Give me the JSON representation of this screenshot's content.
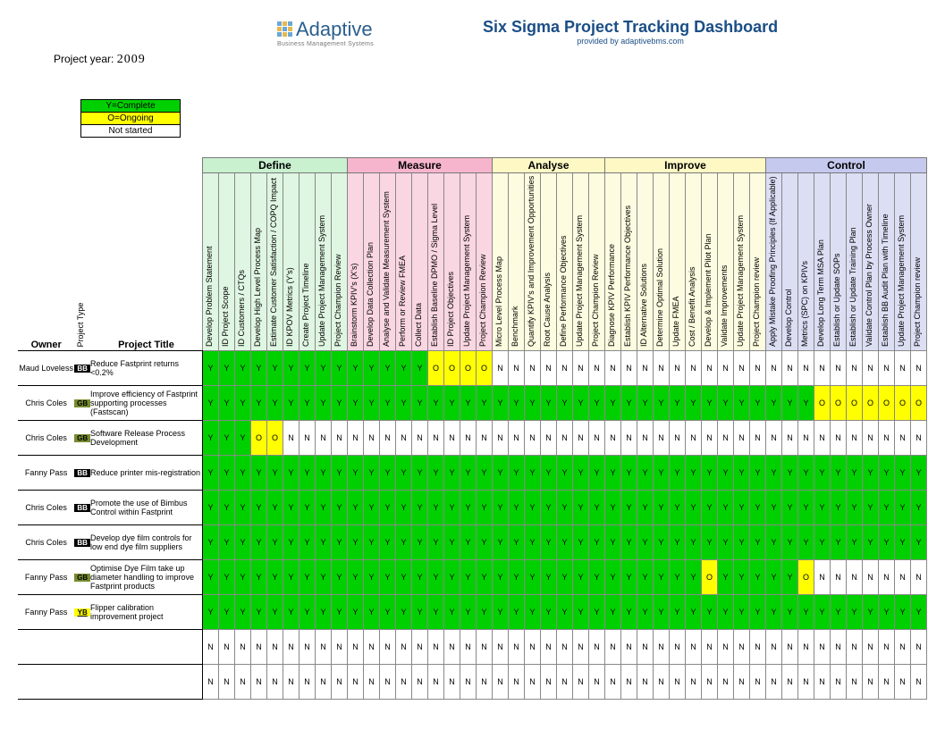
{
  "header": {
    "logo_name": "Adaptive",
    "logo_sub": "Business Management Systems",
    "title": "Six Sigma Project Tracking Dashboard",
    "subtitle": "provided by adaptivebms.com",
    "year_label": "Project year:",
    "year_value": "2009"
  },
  "legend": {
    "complete": "Y=Complete",
    "ongoing": "O=Ongoing",
    "notstarted": "Not started"
  },
  "row_headers": {
    "owner": "Owner",
    "type": "Project Type",
    "title": "Project Title"
  },
  "phases": [
    {
      "name": "Define",
      "cls": "define",
      "cols": [
        "Develop Problem Statement",
        "ID Project Scope",
        "ID Customers / CTQs",
        "Develop High Level Process Map",
        "Estimate Customer Satisfaction / COPQ Impact",
        "ID KPOV Metrics (Y's)",
        "Create Project Timeline",
        "Update Project Management System",
        "Project Champion Review"
      ]
    },
    {
      "name": "Measure",
      "cls": "measure",
      "cols": [
        "Brainstorm KPIV's (X's)",
        "Develop Data Collection Plan",
        "Analyse and Validate Measurement System",
        "Perform or Review FMEA",
        "Collect Data",
        "Establish Baseline DPMO / Sigma Level",
        "ID Project Objectives",
        "Update Project Management System",
        "Project Champion Review"
      ]
    },
    {
      "name": "Analyse",
      "cls": "analyse",
      "cols": [
        "Micro Level Process Map",
        "Benchmark",
        "Quantify KPIV's and Improvement Opportunities",
        "Root Cause Analysis",
        "Define Performance Objectives",
        "Update Project Management System",
        "Project Champion Review"
      ]
    },
    {
      "name": "Improve",
      "cls": "improve",
      "cols": [
        "Diagnose KPIV Performance",
        "Establish KPIV Performance Objectives",
        "ID Alternative Solutions",
        "Determine Optimal Solution",
        "Update FMEA",
        "Cost / Benefit Analysis",
        "Develop & Implement Pilot Plan",
        "Validate Improvements",
        "Update Project Management System",
        "Project Champion review"
      ]
    },
    {
      "name": "Control",
      "cls": "control",
      "cols": [
        "Apply Mistake Proofing Principles (If Applicable)",
        "Develop Control",
        "Metrics (SPC) on KPIVs",
        "Develop Long Term MSA Plan",
        "Establish or Update SOPs",
        "Establish or Update Training Plan",
        "Validate Control Plan by Process Owner",
        "Establish BB Audit Plan with Timeline",
        "Update Project Management System",
        "Project Champion review"
      ]
    }
  ],
  "rows": [
    {
      "owner": "Maud Loveless",
      "type": "BB",
      "title": "Reduce Fastprint returns <0.2%",
      "cells": "YYYYYYYYYYYYYYOOOONNNNNNNNNNNNNNNNNNNNNNNNNNN"
    },
    {
      "owner": "Chris Coles",
      "type": "GB",
      "title": "Improve efficiency of Fastprint supporting processes (Fastscan)",
      "cells": "YYYYYYYYYYYYYYYYYYYYYYYYYYYYYYYYYYYYYYOOOOOOO"
    },
    {
      "owner": "Chris Coles",
      "type": "GB",
      "title": "Software Release Process Development",
      "cells": "YYYOONNNNNNNNNNNNNNNNNNNNNNNNNNNNNNNNNNNNNNNN"
    },
    {
      "owner": "Fanny Pass",
      "type": "BB",
      "title": "Reduce printer mis-registration",
      "cells": "YYYYYYYYYYYYYYYYYYYYYYYYYYYYYYYYYYYYYYYYYYYYY"
    },
    {
      "owner": "Chris Coles",
      "type": "BB",
      "title": "Promote the use of Bimbus Control within Fastprint",
      "cells": "YYYYYYYYYYYYYYYYYYYYYYYYYYYYYYYYYYYYYYYYYYYYY"
    },
    {
      "owner": "Chris Coles",
      "type": "BB",
      "title": "Develop dye film controls for low end dye film suppliers",
      "cells": "YYYYYYYYYYYYYYYYYYYYYYYYYYYYYYYYYYYYYYYYYYYYY"
    },
    {
      "owner": "Fanny Pass",
      "type": "GB",
      "title": "Optimise Dye Film take up diameter handling to improve Fastprint products",
      "cells": "YYYYYYYYYYYYYYYYYYYYYYYYYYYYYYYOYYYYYONNNNNNN"
    },
    {
      "owner": "Fanny Pass",
      "type": "YB",
      "title": "Flipper calibration improvement project",
      "cells": "YYYYYYYYYYYYYYYYYYYYYYYYYYYYYYYYYYYYYYYYYYYYY"
    },
    {
      "owner": "",
      "type": "",
      "title": "",
      "cells": "NNNNNNNNNNNNNNNNNNNNNNNNNNNNNNNNNNNNNNNNNNNNN"
    },
    {
      "owner": "",
      "type": "",
      "title": "",
      "cells": "NNNNNNNNNNNNNNNNNNNNNNNNNNNNNNNNNNNNNNNNNNNNN"
    }
  ]
}
